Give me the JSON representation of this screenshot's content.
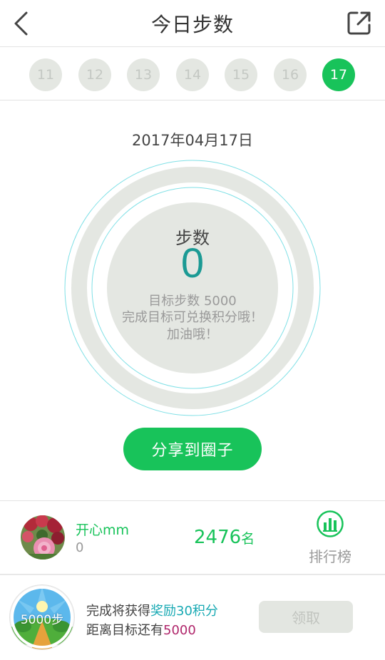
{
  "header": {
    "title": "今日步数"
  },
  "days": [
    {
      "label": "11",
      "active": false
    },
    {
      "label": "12",
      "active": false
    },
    {
      "label": "13",
      "active": false
    },
    {
      "label": "14",
      "active": false
    },
    {
      "label": "15",
      "active": false
    },
    {
      "label": "16",
      "active": false
    },
    {
      "label": "17",
      "active": true
    }
  ],
  "date": "2017年04月17日",
  "ring": {
    "label": "步数",
    "value": "0",
    "goal_line": "目标步数 5000",
    "hint_line": "完成目标可兑换积分哦！",
    "cheer_line": "加油哦！",
    "progress": 0
  },
  "share_circle_label": "分享到圈子",
  "ranking": {
    "user_name": "开心mm",
    "user_steps": "0",
    "rank_number": "2476",
    "rank_unit": "名",
    "board_label": "排行榜"
  },
  "reward": {
    "badge_text": "5000步",
    "line1_prefix": "完成将获得",
    "line1_highlight": "奖励30积分",
    "line2_prefix": "距离目标还有",
    "line2_highlight": "5000",
    "claim_label": "领取"
  },
  "colors": {
    "accent_green": "#18c35a",
    "steps_teal": "#1b9a94",
    "reward_teal": "#17a9b3",
    "reward_magenta": "#b0266b",
    "ring_gray": "#e4e7e2"
  },
  "icons": {
    "back": "chevron-left-icon",
    "share": "external-share-icon",
    "board": "bar-chart-icon"
  }
}
